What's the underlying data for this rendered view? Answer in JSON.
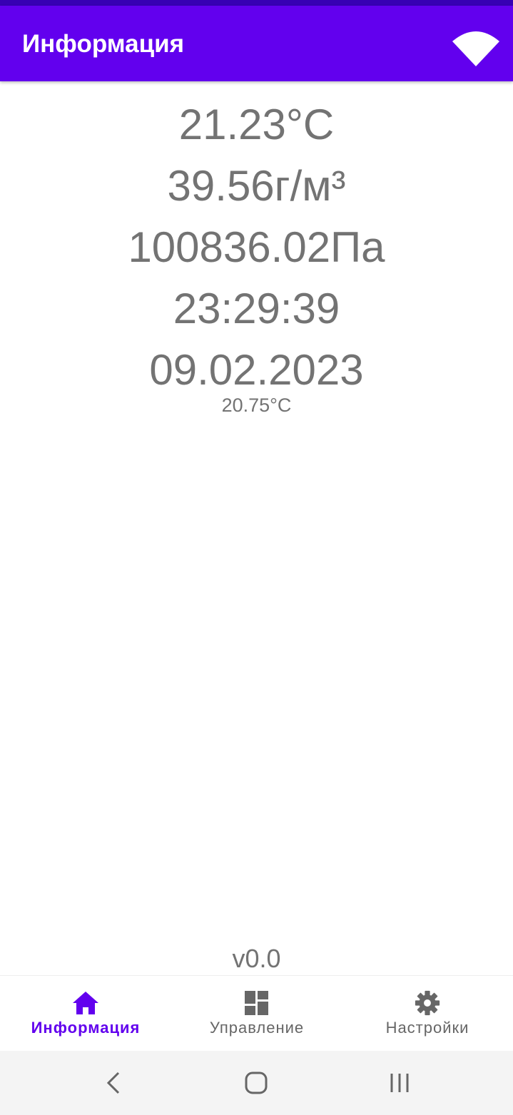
{
  "app_bar": {
    "title": "Информация",
    "wifi_icon": "wifi-icon",
    "background": "#6200ee"
  },
  "readings": {
    "temperature": "21.23°C",
    "humidity": "39.56г/м³",
    "pressure": "100836.02Па",
    "time": "23:29:39",
    "date": "09.02.2023",
    "secondary_temperature": "20.75°C"
  },
  "version": "v0.0",
  "bottom_nav": {
    "items": [
      {
        "label": "Информация",
        "icon": "home-icon",
        "active": true
      },
      {
        "label": "Управление",
        "icon": "dashboard-icon",
        "active": false
      },
      {
        "label": "Настройки",
        "icon": "settings-gear-icon",
        "active": false
      }
    ],
    "active_color": "#6200ee",
    "inactive_color": "#666666"
  },
  "system_nav": {
    "back": "back-icon",
    "home": "home-circle-icon",
    "recents": "recents-icon"
  }
}
